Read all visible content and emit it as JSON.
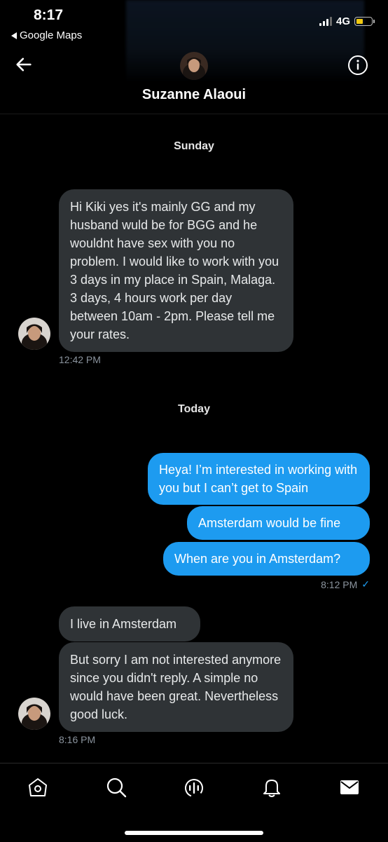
{
  "status_bar": {
    "time": "8:17",
    "back_app": "Google Maps",
    "network": "4G",
    "battery_color": "#f2c90f"
  },
  "header": {
    "name": "Suzanne Alaoui"
  },
  "conversation": {
    "day1": "Sunday",
    "msg1": "Hi Kiki yes it's mainly GG and my husband wuld be for BGG and he wouldnt have sex with you no problem. I would like to work with you 3 days in my place in Spain, Malaga. 3 days, 4 hours work per day between 10am - 2pm. Please tell me your rates.",
    "msg1_time": "12:42 PM",
    "day2": "Today",
    "out1": "Heya! I’m interested in working with you but I can’t get to Spain",
    "out2": "Amsterdam would be fine",
    "out3": "When are you in Amsterdam?",
    "out_time": "8:12 PM",
    "in2": "I live in Amsterdam",
    "in3": "But sorry I am not interested anymore since you didn't reply. A simple no would have been great. Nevertheless good luck.",
    "in_time": "8:16 PM"
  },
  "colors": {
    "outgoing_bubble": "#1d9bf0",
    "incoming_bubble": "#2f3336"
  },
  "tabbar": {
    "icons": [
      "home-icon",
      "search-icon",
      "spaces-icon",
      "notifications-icon",
      "messages-icon"
    ]
  }
}
